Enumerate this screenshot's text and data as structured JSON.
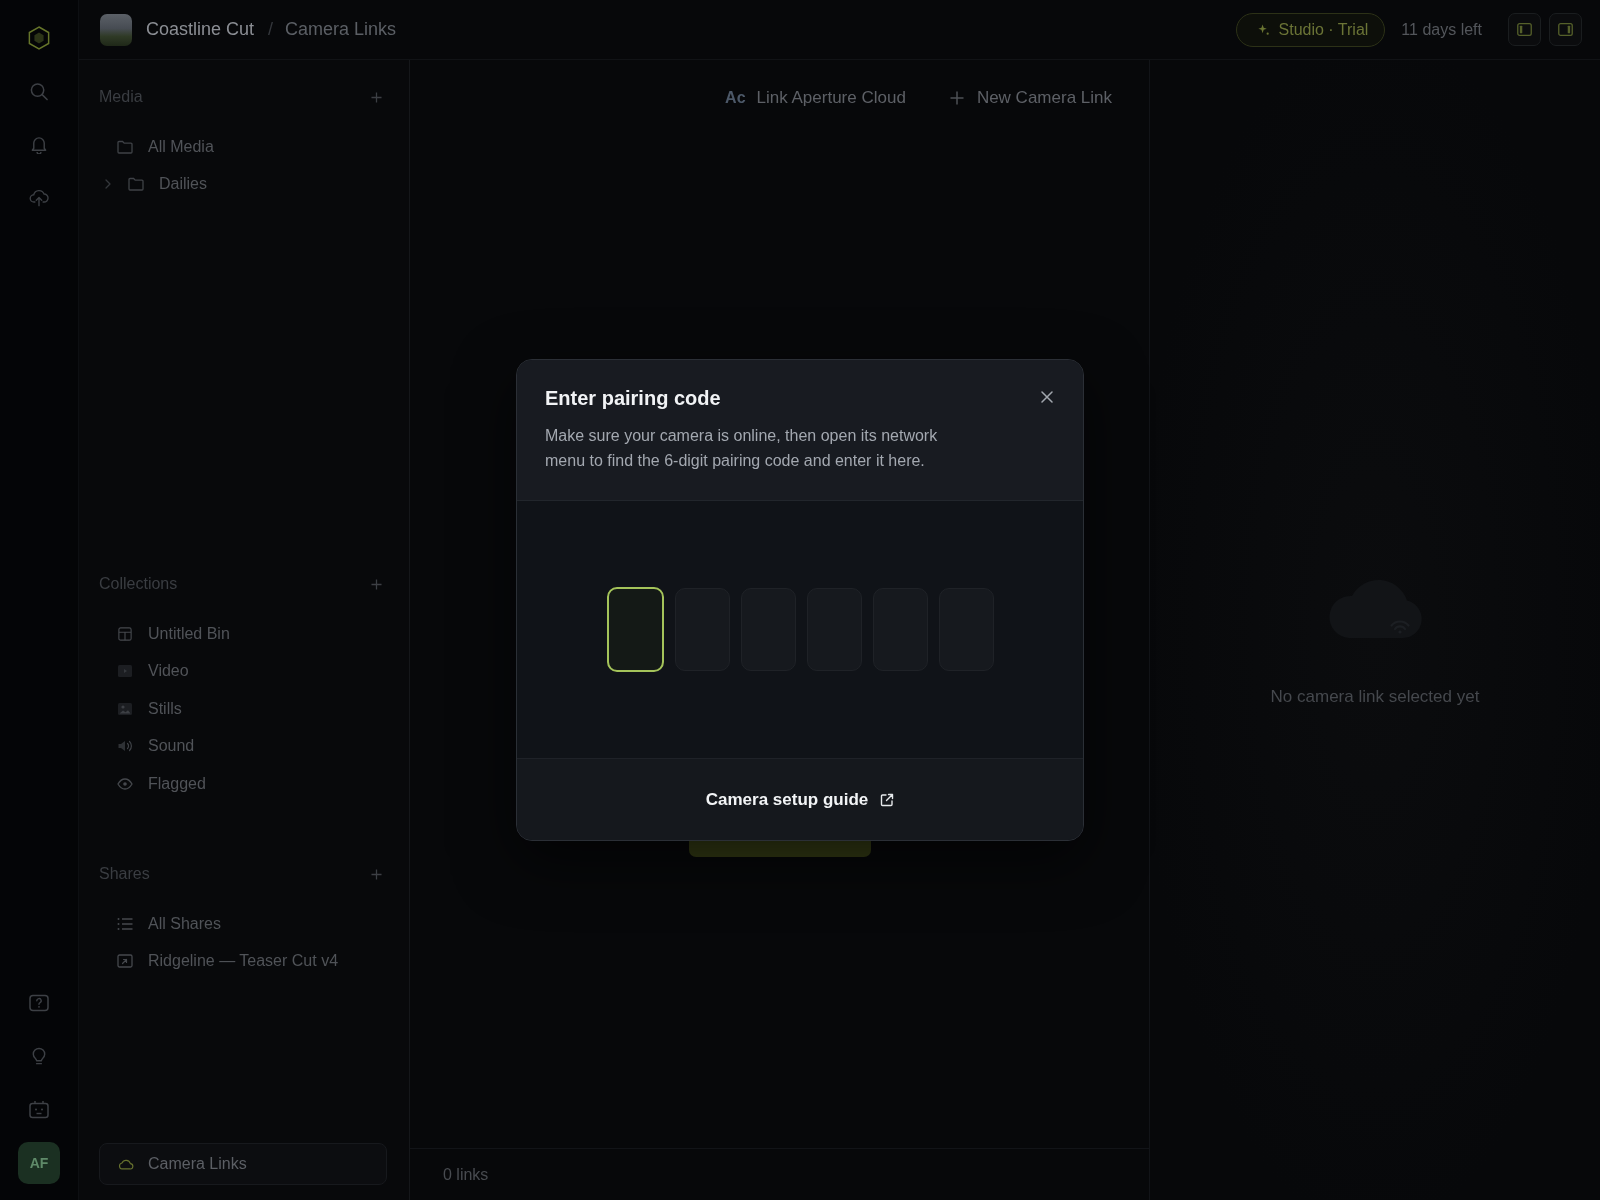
{
  "rail": {
    "avatar": {
      "initials": "AF"
    }
  },
  "topbar": {
    "project": "Coastline Cut",
    "separator": "/",
    "page": "Camera Links",
    "plan_badge": "Studio · Trial",
    "trial_note": "11 days left"
  },
  "sidebar": {
    "sections": [
      {
        "title": "Media",
        "items": [
          {
            "kind": "item",
            "label": "All Media"
          },
          {
            "kind": "group",
            "label": "Dailies",
            "expanded": false
          }
        ]
      },
      {
        "title": "Collections",
        "items": [
          {
            "kind": "item",
            "label": "Untitled Bin"
          },
          {
            "kind": "item",
            "label": "Video"
          },
          {
            "kind": "item",
            "label": "Stills"
          },
          {
            "kind": "item",
            "label": "Sound"
          },
          {
            "kind": "item",
            "label": "Flagged"
          }
        ]
      },
      {
        "title": "Shares",
        "items": [
          {
            "kind": "item",
            "label": "All Shares"
          },
          {
            "kind": "item",
            "label": "Ridgeline — Teaser Cut v4"
          }
        ]
      }
    ],
    "footer_item": {
      "label": "Camera Links",
      "selected": true
    }
  },
  "toolbar": {
    "actions": [
      {
        "kind": "badge",
        "badge": "Ac",
        "label": "Link Aperture Cloud"
      },
      {
        "kind": "add",
        "label": "New Camera Link"
      }
    ]
  },
  "status_bar": {
    "count": "0 links"
  },
  "detail": {
    "empty_message": "No camera link selected yet"
  },
  "dialog": {
    "title": "Enter pairing code",
    "description": "Make sure your camera is online, then open its network menu to find the 6-digit pairing code and enter it here.",
    "code_fields": [
      {
        "focused": true
      },
      {
        "focused": false
      },
      {
        "focused": false
      },
      {
        "focused": false
      },
      {
        "focused": false
      },
      {
        "focused": false
      }
    ],
    "link": "Camera setup guide"
  }
}
